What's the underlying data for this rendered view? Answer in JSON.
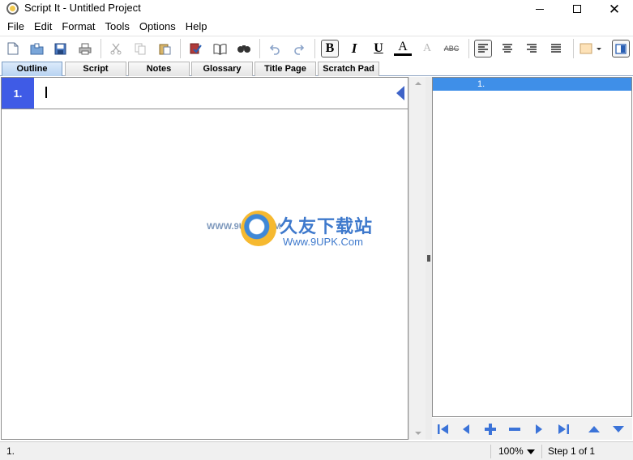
{
  "window": {
    "title": "Script It - Untitled Project",
    "controls": {
      "minimize": "minimize-icon",
      "maximize": "maximize-icon",
      "close": "✕"
    }
  },
  "menu": [
    "File",
    "Edit",
    "Format",
    "Tools",
    "Options",
    "Help"
  ],
  "toolbar": {
    "bold": "B",
    "italic": "I",
    "underline": "U",
    "text_color": "A",
    "clear_format": "A",
    "strikethrough": "ABC",
    "icons": [
      "new-icon",
      "open-icon",
      "save-icon",
      "print-icon",
      "cut-icon",
      "copy-icon",
      "paste-icon",
      "spellcheck-icon",
      "dictionary-icon",
      "find-icon",
      "undo-icon",
      "redo-icon",
      "align-left-icon",
      "align-center-icon",
      "align-right-icon",
      "justify-icon",
      "highlight-color-icon",
      "toggle-pane-icon"
    ]
  },
  "tabs": [
    {
      "label": "Outline",
      "active": true
    },
    {
      "label": "Script",
      "active": false
    },
    {
      "label": "Notes",
      "active": false
    },
    {
      "label": "Glossary",
      "active": false
    },
    {
      "label": "Title Page",
      "active": false
    },
    {
      "label": "Scratch Pad",
      "active": false
    }
  ],
  "outline": {
    "rows": [
      {
        "number": "1.",
        "text": ""
      }
    ]
  },
  "right_panel": {
    "items": [
      {
        "label": "1.",
        "selected": true
      }
    ]
  },
  "nav_buttons": [
    "first-icon",
    "prev-icon",
    "add-icon",
    "remove-icon",
    "next-icon",
    "last-icon",
    "move-up-icon",
    "move-down-icon"
  ],
  "status": {
    "position": "1.",
    "zoom": "100%",
    "step": "Step 1 of 1"
  },
  "watermark": {
    "left_text": "WWW.9UPK.COM",
    "name": "久友下载站",
    "url": "Www.9UPK.Com"
  },
  "colors": {
    "selection": "#3f5be6",
    "right_selection": "#3f8fe8",
    "tab_active": "#b8d3f1",
    "nav_blue": "#3b73d8"
  }
}
